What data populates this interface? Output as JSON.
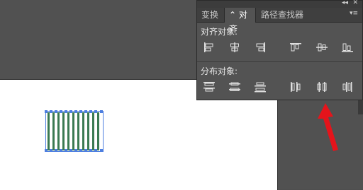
{
  "tabs": [
    {
      "label": "变换"
    },
    {
      "label": "⌃ 对齐"
    },
    {
      "label": "路径查找器"
    }
  ],
  "panel_controls": {
    "collapse": "◂◂",
    "close": "✕",
    "menu": "▾≡"
  },
  "align_section": {
    "label": "对齐对象:",
    "buttons": [
      "horizontal-align-left",
      "horizontal-align-center",
      "horizontal-align-right",
      "vertical-align-top",
      "vertical-align-center",
      "vertical-align-bottom"
    ]
  },
  "distribute_section": {
    "label": "分布对象:",
    "buttons": [
      "vertical-distribute-top",
      "vertical-distribute-center",
      "vertical-distribute-bottom",
      "horizontal-distribute-left",
      "horizontal-distribute-center",
      "horizontal-distribute-right"
    ]
  },
  "colors": {
    "selection": "#4e7fe0",
    "stripes": "#3b7a52",
    "annotation_arrow": "#e5141b"
  }
}
